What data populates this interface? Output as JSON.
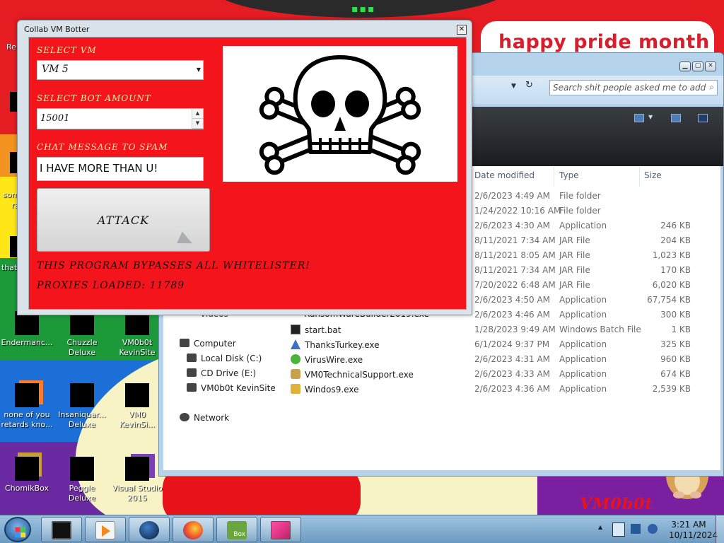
{
  "wallpaper": {
    "banner_text": "happy pride month",
    "logo_text": "VM0b0t"
  },
  "desktop_icons": [
    {
      "label": "Endermanc...",
      "row": 0,
      "col": 0
    },
    {
      "label": "Chuzzle Deluxe",
      "row": 0,
      "col": 1
    },
    {
      "label": "VM0b0t KevinSite",
      "row": 0,
      "col": 2
    },
    {
      "label": "none of you retards kno...",
      "row": 1,
      "col": 0
    },
    {
      "label": "Insaniquar... Deluxe",
      "row": 1,
      "col": 1
    },
    {
      "label": "VM0 KevinSi...",
      "row": 1,
      "col": 2
    },
    {
      "label": "ChomikBox",
      "row": 2,
      "col": 0
    },
    {
      "label": "Peggle Deluxe",
      "row": 2,
      "col": 1
    },
    {
      "label": "Visual Studio 2015",
      "row": 2,
      "col": 2
    }
  ],
  "desktop_partial_labels": [
    "Re",
    "som",
    "ra",
    "that"
  ],
  "botter": {
    "title": "Collab VM Botter",
    "close_symbol": "✕",
    "select_vm_label": "SELECT VM",
    "select_vm_value": "VM 5",
    "bot_amount_label": "SELECT BOT AMOUNT",
    "bot_amount_value": "15001",
    "chat_label": "CHAT MESSAGE TO SPAM",
    "chat_value": "I HAVE MORE THAN U!",
    "attack_label": "ATTACK",
    "bypass_text": "THIS PROGRAM BYPASSES ALL WHITELISTER!",
    "proxies_text": "PROXIES LOADED: 11789",
    "image_icon": "skull-and-crossbones"
  },
  "explorer": {
    "search_placeholder": "Search shit people asked me to add",
    "columns": {
      "date": "Date modified",
      "type": "Type",
      "size": "Size"
    },
    "rows": [
      {
        "name": "",
        "date": "2/6/2023 4:49 AM",
        "type": "File folder",
        "size": ""
      },
      {
        "name": "",
        "date": "1/24/2022 10:16 AM",
        "type": "File folder",
        "size": ""
      },
      {
        "name": "",
        "date": "2/6/2023 4:30 AM",
        "type": "Application",
        "size": "246 KB"
      },
      {
        "name": "",
        "date": "8/11/2021 7:34 AM",
        "type": "JAR File",
        "size": "204 KB"
      },
      {
        "name": "",
        "date": "8/11/2021 8:05 AM",
        "type": "JAR File",
        "size": "1,023 KB"
      },
      {
        "name": "",
        "date": "8/11/2021 7:34 AM",
        "type": "JAR File",
        "size": "170 KB"
      },
      {
        "name": "",
        "date": "7/20/2022 6:48 AM",
        "type": "JAR File",
        "size": "6,020 KB"
      },
      {
        "name": "",
        "date": "2/6/2023 4:50 AM",
        "type": "Application",
        "size": "67,754 KB"
      },
      {
        "name": "",
        "date": "2/6/2023 4:46 AM",
        "type": "Application",
        "size": "300 KB"
      },
      {
        "name": "start.bat",
        "date": "1/28/2023 9:49 AM",
        "type": "Windows Batch File",
        "size": "1 KB"
      },
      {
        "name": "ThanksTurkey.exe",
        "date": "6/1/2024 9:37 PM",
        "type": "Application",
        "size": "325 KB"
      },
      {
        "name": "VirusWire.exe",
        "date": "2/6/2023 4:31 AM",
        "type": "Application",
        "size": "960 KB"
      },
      {
        "name": "VM0TechnicalSupport.exe",
        "date": "2/6/2023 4:33 AM",
        "type": "Application",
        "size": "674 KB"
      },
      {
        "name": "Windos9.exe",
        "date": "2/6/2023 4:36 AM",
        "type": "Application",
        "size": "2,539 KB"
      }
    ],
    "partial_row": "RansomWareBuilder2019.exe",
    "partial_nav": "Videos",
    "nav": [
      {
        "label": "Computer",
        "indent": 0
      },
      {
        "label": "Local Disk (C:)",
        "indent": 1
      },
      {
        "label": "CD Drive (E:)",
        "indent": 1
      },
      {
        "label": "VM0b0t KevinSite",
        "indent": 1
      },
      {
        "label": "Network",
        "indent": 0
      }
    ]
  },
  "taskbar": {
    "apps": [
      "terminal",
      "media-player",
      "globe",
      "firefox",
      "chomikbox",
      "pink-app"
    ],
    "chomikbox_label": "Box",
    "time": "3:21 AM",
    "date": "10/11/2024"
  }
}
